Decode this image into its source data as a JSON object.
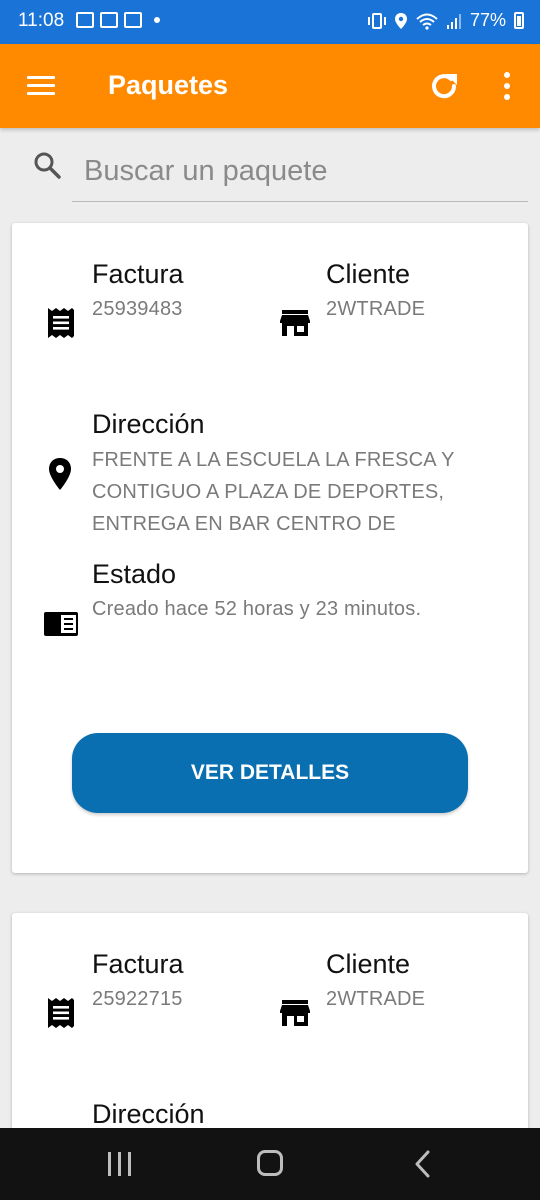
{
  "status_bar": {
    "time": "11:08",
    "battery": "77%"
  },
  "app_bar": {
    "title": "Paquetes"
  },
  "search": {
    "placeholder": "Buscar un paquete"
  },
  "labels": {
    "invoice": "Factura",
    "client": "Cliente",
    "address": "Dirección",
    "status": "Estado",
    "details_button": "VER DETALLES"
  },
  "packages": [
    {
      "invoice": "25939483",
      "client": "2WTRADE",
      "address_lines": [
        "FRENTE A LA ESCUELA LA FRESCA Y",
        "CONTIGUO A PLAZA DE DEPORTES,",
        "ENTREGA EN BAR CENTRO DE"
      ],
      "status": "Creado hace 52 horas y 23 minutos."
    },
    {
      "invoice": "25922715",
      "client": "2WTRADE"
    }
  ],
  "colors": {
    "status_bar": "#1a74d8",
    "app_bar": "#ff8a00",
    "button": "#0a6fb0",
    "background": "#ededed"
  },
  "icons": {
    "invoice": "receipt-icon",
    "client": "store-icon",
    "address": "location-pin-icon",
    "status": "status-card-icon",
    "refresh": "refresh-icon",
    "more": "more-vert-icon",
    "menu": "menu-icon",
    "search": "search-icon"
  }
}
